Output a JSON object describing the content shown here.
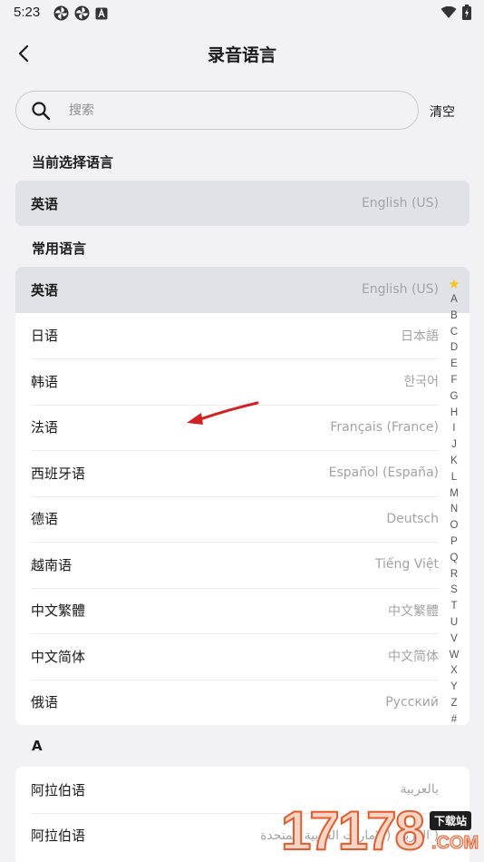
{
  "status_bar": {
    "time": "5:23",
    "left_icons": [
      "pinwheel-icon",
      "pinwheel-icon",
      "notification-a-icon"
    ],
    "right_icons": [
      "wifi-icon",
      "battery-charging-icon"
    ]
  },
  "header": {
    "title": "录音语言",
    "back_icon": "chevron-left-icon"
  },
  "search": {
    "placeholder": "搜索",
    "value": "",
    "clear_label": "清空"
  },
  "current_section": {
    "title": "当前选择语言",
    "item": {
      "name": "英语",
      "native": "English (US)"
    }
  },
  "common_section": {
    "title": "常用语言",
    "items": [
      {
        "name": "英语",
        "native": "English (US)",
        "selected": true
      },
      {
        "name": "日语",
        "native": "日本語"
      },
      {
        "name": "韩语",
        "native": "한국어"
      },
      {
        "name": "法语",
        "native": "Français (France)"
      },
      {
        "name": "西班牙语",
        "native": "Español (España)"
      },
      {
        "name": "德语",
        "native": "Deutsch"
      },
      {
        "name": "越南语",
        "native": "Tiếng Việt"
      },
      {
        "name": "中文繁體",
        "native": "中文繁體"
      },
      {
        "name": "中文简体",
        "native": "中文简体"
      },
      {
        "name": "俄语",
        "native": "Русский"
      }
    ]
  },
  "a_section": {
    "title": "A",
    "items": [
      {
        "name": "阿拉伯语",
        "native": "بالعربية"
      },
      {
        "name": "阿拉伯语",
        "native": "( العربية (الإمارات العربية المتحدة"
      }
    ]
  },
  "index_bar": {
    "star_icon": "star-icon",
    "letters": [
      "A",
      "B",
      "C",
      "D",
      "E",
      "F",
      "G",
      "H",
      "I",
      "J",
      "K",
      "L",
      "M",
      "N",
      "O",
      "P",
      "Q",
      "R",
      "S",
      "T",
      "U",
      "V",
      "W",
      "X",
      "Y",
      "Z",
      "#"
    ]
  },
  "watermark": {
    "digits": "17178",
    "tag": "下载站",
    "suffix": ".COM"
  },
  "colors": {
    "accent_star": "#f5c518",
    "selected_row": "#e1e2e8",
    "arrow": "#d42020",
    "watermark": "#e85a27"
  }
}
